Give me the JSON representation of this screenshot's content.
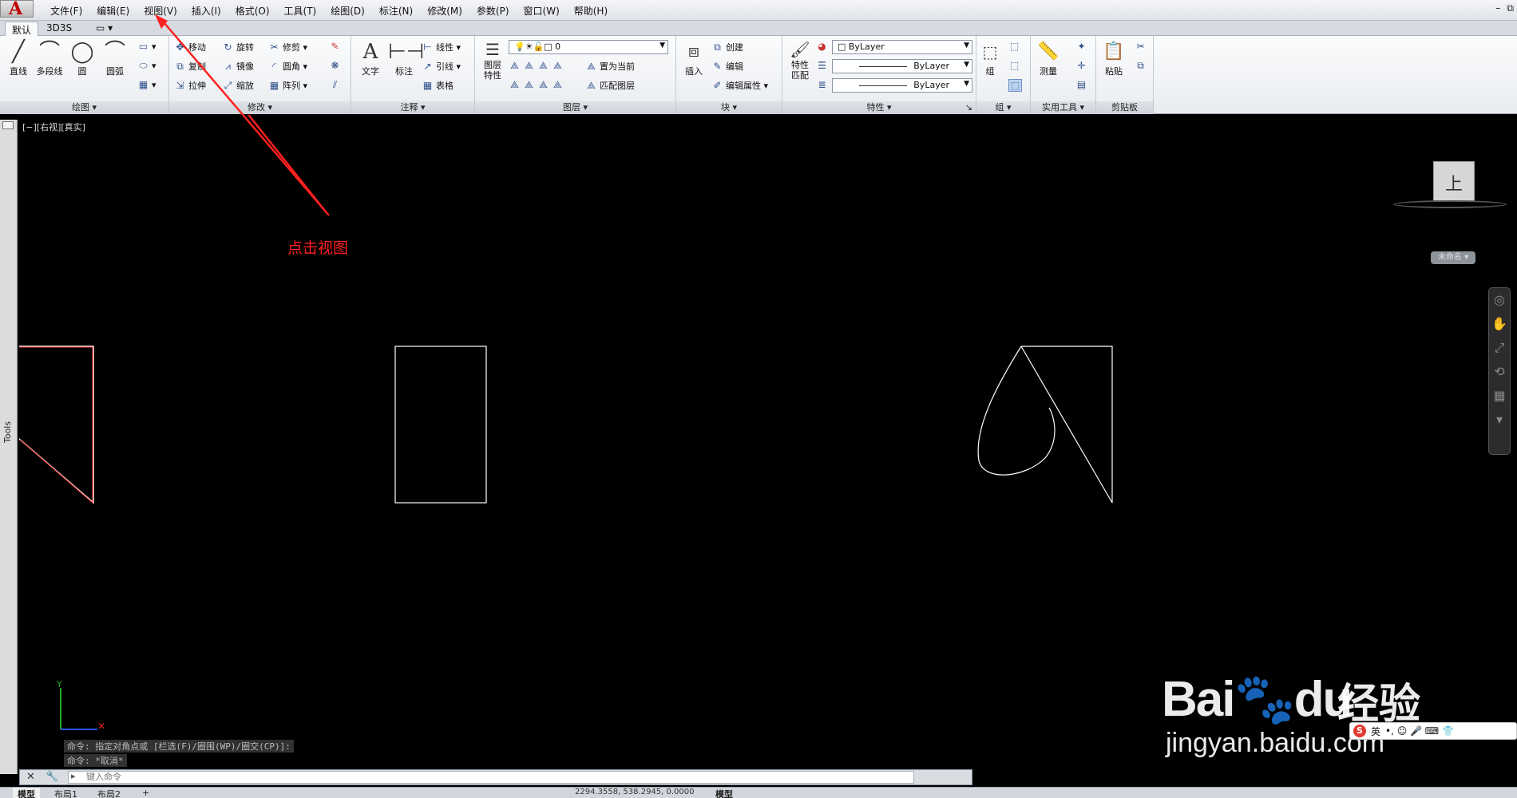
{
  "app": {
    "logo_letter": "A",
    "accent": "#c00000"
  },
  "menu": [
    "文件(F)",
    "编辑(E)",
    "视图(V)",
    "插入(I)",
    "格式(O)",
    "工具(T)",
    "绘图(D)",
    "标注(N)",
    "修改(M)",
    "参数(P)",
    "窗口(W)",
    "帮助(H)"
  ],
  "window_controls": {
    "minimize": "–",
    "restore": "⧉"
  },
  "ribbon_tabs": {
    "default": "默认",
    "tab2": "3D3S",
    "extra": "▭ ▾"
  },
  "draw": {
    "line": "直线",
    "polyline": "多段线",
    "circle": "圆",
    "arc": "圆弧",
    "title": "绘图 ▾"
  },
  "modify": {
    "move": "移动",
    "rotate": "旋转",
    "trim": "修剪 ▾",
    "copy": "复制",
    "mirror": "镜像",
    "fillet": "圆角 ▾",
    "stretch": "拉伸",
    "scale": "缩放",
    "array": "阵列 ▾",
    "title": "修改 ▾"
  },
  "annotation": {
    "text": "文字",
    "dimension": "标注",
    "linear": "线性 ▾",
    "leader": "引线 ▾",
    "table": "表格",
    "title": "注释 ▾"
  },
  "layers": {
    "properties": "图层\n特性",
    "current_layer": "0",
    "set_current": "置为当前",
    "match_layer": "匹配图层",
    "title": "图层 ▾"
  },
  "block": {
    "insert": "插入",
    "create": "创建",
    "edit": "编辑",
    "edit_attr": "编辑属性 ▾",
    "title": "块 ▾"
  },
  "properties": {
    "match": "特性\n匹配",
    "color": "ByLayer",
    "linetype": "ByLayer",
    "lineweight": "ByLayer",
    "title": "特性 ▾",
    "launcher": "↘"
  },
  "groups": {
    "group": "组",
    "title": "组 ▾"
  },
  "utilities": {
    "measure": "测量",
    "title": "实用工具 ▾"
  },
  "clipboard": {
    "paste": "粘贴",
    "title": "剪贴板"
  },
  "tools_strip": {
    "label": "Tools"
  },
  "viewport": {
    "label": "[−][右视][真实]"
  },
  "viewcube": {
    "face": "上",
    "name_badge": "未命名 ▾"
  },
  "callout": {
    "text": "点击视图",
    "color": "#ff2020"
  },
  "command_history": [
    "命令: 指定对角点或 [栏选(F)/圈围(WP)/圈交(CP)]:",
    "命令: *取消*"
  ],
  "command_line": {
    "placeholder": "键入命令",
    "close": "✕",
    "wrench": "🔧"
  },
  "layout_tabs": [
    "模型",
    "布局1",
    "布局2",
    "+"
  ],
  "status": {
    "coords": "2294.3558, 538.2945, 0.0000",
    "model": "模型"
  },
  "watermark": {
    "brand": "Bai",
    "paw": "du",
    "cn": "经验",
    "url": "jingyan.baidu.com"
  },
  "ime": {
    "s": "S",
    "lang": "英",
    "items": "•, ☺ 🎤 ⌨ 👕"
  }
}
